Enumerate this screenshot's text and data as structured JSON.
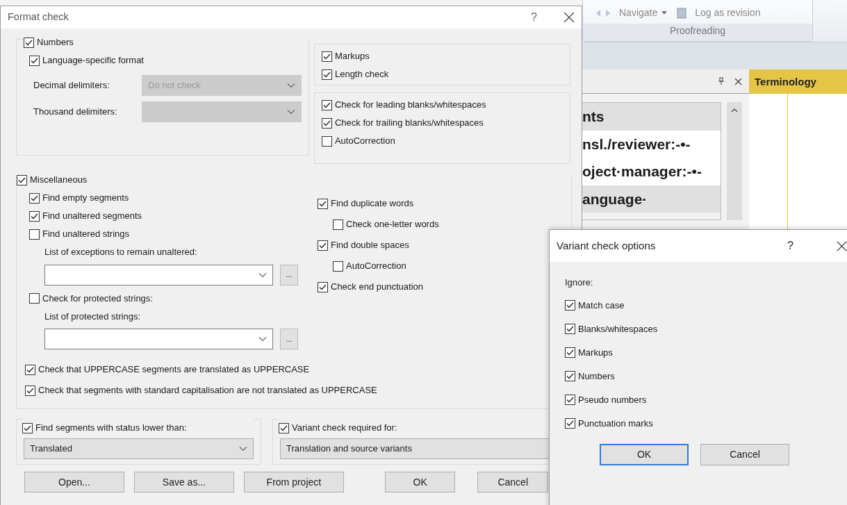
{
  "app": {
    "ribbon": {
      "items": [
        {
          "kind": "navigate",
          "label": "Navigate"
        },
        {
          "kind": "log",
          "label": "Log as revision"
        }
      ],
      "group": "Proofreading"
    },
    "panel": {
      "tab": "Terminology",
      "lines": [
        {
          "text": "nts",
          "shaded": true
        },
        {
          "text": "nsl./reviewer:-•-",
          "shaded": false
        },
        {
          "text": "oject·manager:-•-",
          "shaded": false
        },
        {
          "text": "anguage·",
          "shaded": true
        }
      ]
    }
  },
  "format_dialog": {
    "title": "Format check",
    "help": "?",
    "numbers": {
      "label": "Numbers",
      "checked": true,
      "options": [
        {
          "label": "Language-specific format",
          "checked": true
        }
      ],
      "dropdowns": [
        {
          "label": "Decimal delimiters:",
          "value": "Do not check",
          "disabled": true
        },
        {
          "label": "Thousand delimiters:",
          "disabled": true
        }
      ]
    },
    "tags_group": [
      {
        "label": "Markups",
        "checked": true
      },
      {
        "label": "Length check",
        "checked": true
      }
    ],
    "blanks_group": [
      {
        "label": "Check for leading blanks/whitespaces",
        "checked": true
      },
      {
        "label": "Check for trailing blanks/whitespaces",
        "checked": true
      },
      {
        "label": "AutoCorrection",
        "checked": false
      }
    ],
    "misc": {
      "label": "Miscellaneous",
      "checked": true,
      "left": [
        {
          "label": "Find empty segments",
          "checked": true
        },
        {
          "label": "Find unaltered segments",
          "checked": true
        },
        {
          "label": "Find unaltered strings",
          "checked": false,
          "list": {
            "label": "List of exceptions to remain unaltered:",
            "button": "..."
          }
        },
        {
          "label": "Check for protected strings:",
          "checked": false,
          "list": {
            "label": "List of protected strings:",
            "button": "..."
          }
        }
      ],
      "right": [
        {
          "label": "Find duplicate words",
          "checked": true,
          "children": [
            {
              "label": "Check one-letter words",
              "checked": false
            }
          ]
        },
        {
          "label": "Find double spaces",
          "checked": true,
          "children": [
            {
              "label": "AutoCorrection",
              "checked": false
            }
          ]
        },
        {
          "label": "Check end punctuation",
          "checked": true
        }
      ],
      "full": [
        {
          "label": "Check that UPPERCASE segments are translated as UPPERCASE",
          "checked": true
        },
        {
          "label": "Check that segments with standard capitalisation are not translated as UPPERCASE",
          "checked": true
        }
      ]
    },
    "status_filter": {
      "label": "Find segments with status lower than:",
      "checked": true,
      "value": "Translated"
    },
    "variant_required": {
      "label": "Variant check required for:",
      "checked": true,
      "value": "Translation and source variants"
    },
    "buttons": [
      {
        "label": "Open..."
      },
      {
        "label": "Save as..."
      },
      {
        "label": "From project"
      },
      {
        "label": "OK"
      },
      {
        "label": "Cancel"
      }
    ]
  },
  "variant_dialog": {
    "title": "Variant check options",
    "help": "?",
    "heading": "Ignore:",
    "options": [
      {
        "label": "Match case",
        "checked": true
      },
      {
        "label": "Blanks/whitespaces",
        "checked": true
      },
      {
        "label": "Markups",
        "checked": true
      },
      {
        "label": "Numbers",
        "checked": true
      },
      {
        "label": "Pseudo numbers",
        "checked": true
      },
      {
        "label": "Punctuation marks",
        "checked": true
      }
    ],
    "buttons": [
      {
        "label": "OK",
        "default": true
      },
      {
        "label": "Cancel",
        "default": false
      }
    ]
  }
}
